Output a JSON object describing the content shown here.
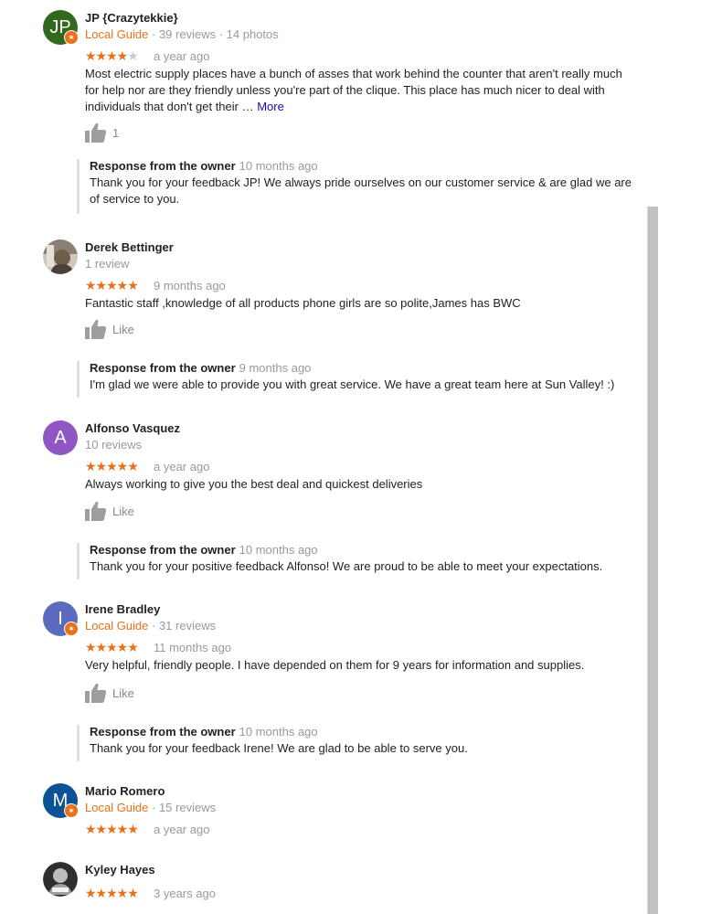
{
  "reviews": [
    {
      "name": "JP {Crazytekkie}",
      "avatar": {
        "initials": "JP",
        "color": "#33691e"
      },
      "local_guide": true,
      "guide_label": "Local Guide",
      "stats": "39 reviews · 14 photos",
      "rating": 4,
      "stars": "★★★★",
      "stars_off": "★",
      "when": "a year ago",
      "text": "Most electric supply places have a bunch of asses that work behind the counter that aren't really much for help nor are they friendly unless you're part of the clique. This place has much nicer to deal with individuals that don't get their … ",
      "more_label": "More",
      "like_label": "1",
      "owner_response": {
        "title": "Response from the owner",
        "when": "10 months ago",
        "text": "Thank you for your feedback JP! We always pride ourselves on our customer service & are glad we are of service to you."
      }
    },
    {
      "name": "Derek Bettinger",
      "avatar": {
        "initials": "",
        "color": "#5d5750"
      },
      "local_guide": false,
      "stats": "1 review",
      "rating": 5,
      "stars": "★★★★★",
      "when": "9 months ago",
      "text": "Fantastic staff ,knowledge of all products phone girls are so polite,James has BWC",
      "like_label": "Like",
      "owner_response": {
        "title": "Response from the owner",
        "when": "9 months ago",
        "text": "I'm glad we were able to provide you with great service. We have a great team here at Sun Valley! :)"
      }
    },
    {
      "name": "Alfonso Vasquez",
      "avatar": {
        "initials": "A",
        "color": "#8e57c4"
      },
      "local_guide": false,
      "stats": "10 reviews",
      "rating": 5,
      "stars": "★★★★★",
      "when": "a year ago",
      "text": "Always working to give you the best deal and quickest deliveries",
      "like_label": "Like",
      "owner_response": {
        "title": "Response from the owner",
        "when": "10 months ago",
        "text": "Thank you for your positive feedback Alfonso! We are proud to be able to meet your expectations."
      }
    },
    {
      "name": "Irene Bradley",
      "avatar": {
        "initials": "I",
        "color": "#5c6bc0"
      },
      "local_guide": true,
      "guide_label": "Local Guide",
      "stats": "31 reviews",
      "rating": 5,
      "stars": "★★★★★",
      "when": "11 months ago",
      "text": "Very helpful,  friendly people. I have depended on them for 9 years for information and supplies.",
      "like_label": "Like",
      "owner_response": {
        "title": "Response from the owner",
        "when": "10 months ago",
        "text": "Thank you for your feedback Irene! We are glad to be able to serve you."
      }
    },
    {
      "name": "Mario Romero",
      "avatar": {
        "initials": "M",
        "color": "#0b5394"
      },
      "local_guide": true,
      "guide_label": "Local Guide",
      "stats": "15 reviews",
      "rating": 5,
      "stars": "★★★★★",
      "when": "a year ago"
    },
    {
      "name": "Kyley Hayes",
      "avatar": {
        "initials": "",
        "color": "#3a3a3a"
      },
      "local_guide": false,
      "rating": 5,
      "stars": "★★★★★",
      "when": "3 years ago"
    }
  ],
  "colors": {
    "star_on": "#e7711b",
    "star_off": "#cccccc",
    "local_guide": "#e8711a",
    "more_link": "#1a0dab",
    "muted_text": "#999999",
    "scrollbar": "#c1c1c1"
  },
  "icons": {
    "thumbs_up": "thumbs-up-icon",
    "local_guide_badge": "local-guide-badge-icon"
  }
}
